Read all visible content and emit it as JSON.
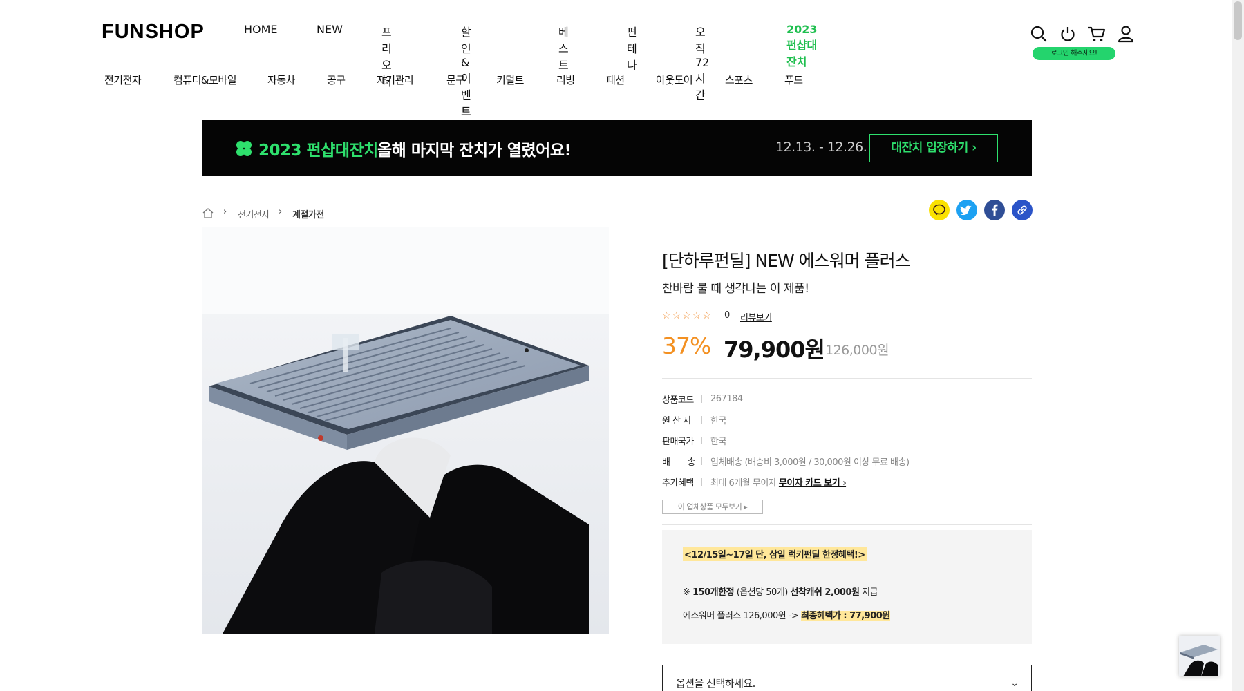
{
  "brand": {
    "logo_text": "FUNSHOP"
  },
  "gnb": [
    {
      "label": "HOME",
      "color": "#111111"
    },
    {
      "label": "NEW",
      "color": "#111111"
    },
    {
      "label": "프리오더",
      "color": "#111111"
    },
    {
      "label": "할인&이벤트",
      "color": "#111111"
    },
    {
      "label": "베스트",
      "color": "#111111"
    },
    {
      "label": "펀테나",
      "color": "#111111"
    },
    {
      "label": "오직72시간",
      "color": "#111111"
    },
    {
      "label": "2023펀샵대잔치",
      "color": "#1fbf4f"
    }
  ],
  "utility": {
    "icons": [
      "search-icon",
      "power-icon",
      "cart-icon",
      "user-icon"
    ],
    "login_tooltip": "로그인 해주세요!"
  },
  "categories": [
    "전기전자",
    "컴퓨터&모바일",
    "자동차",
    "공구",
    "자기관리",
    "문구",
    "키덜트",
    "리빙",
    "패션",
    "아웃도어",
    "스포츠",
    "푸드"
  ],
  "banner": {
    "title": "2023 펀샵대잔치",
    "subtitle": "올해 마지막 잔치가 열렸어요!",
    "dates": "12.13. - 12.26.",
    "cta": "대잔치 입장하기 ›",
    "accent": "#2ee06d"
  },
  "breadcrumb": {
    "level1": "전기전자",
    "level2": "계절가전"
  },
  "share": [
    {
      "icon": "kakaotalk-icon",
      "color": "#fae100"
    },
    {
      "icon": "twitter-icon",
      "color": "#1da1f2"
    },
    {
      "icon": "facebook-icon",
      "color": "#2f4e96"
    },
    {
      "icon": "link-icon",
      "color": "#2b54c8"
    }
  ],
  "product": {
    "title": "[단하루펀딜] NEW 에스워머 플러스",
    "subtitle": "찬바람 불 때 생각나는 이 제품!",
    "rating_stars": "☆☆☆☆☆",
    "review_count": "0",
    "review_link": "리뷰보기",
    "discount": "37%",
    "price": "79,900원",
    "original_price": "126,000원",
    "info": [
      {
        "key": "상품코드",
        "value": "267184"
      },
      {
        "key": "원 산 지",
        "value": "한국"
      },
      {
        "key": "판매국가",
        "value": "한국"
      },
      {
        "key": "배　　송",
        "value": "업체배송 (배송비 3,000원 / 30,000원 이상 무료 배송)"
      },
      {
        "key": "추가혜택",
        "value": "최대 6개월 무이자",
        "link": "무이자 카드 보기 ›"
      }
    ],
    "seller_button": "이 업체상품 모두보기 ▸"
  },
  "promo": {
    "headline": "<12/15일~17일 단, 삼일 럭키펀딜 한정혜택!>",
    "line2_prefix": "※ ",
    "line2_limit": "150개한정",
    "line2_mid": " (옵션당 50개) ",
    "line2_bold": "선착캐쉬 2,000원",
    "line2_suffix": " 지급",
    "line3_prefix": "에스워머 플러스 126,000원 -> ",
    "line3_highlight": "최종혜택가 : 77,900원"
  },
  "option_select": {
    "value": "옵션을 선택하세요."
  }
}
